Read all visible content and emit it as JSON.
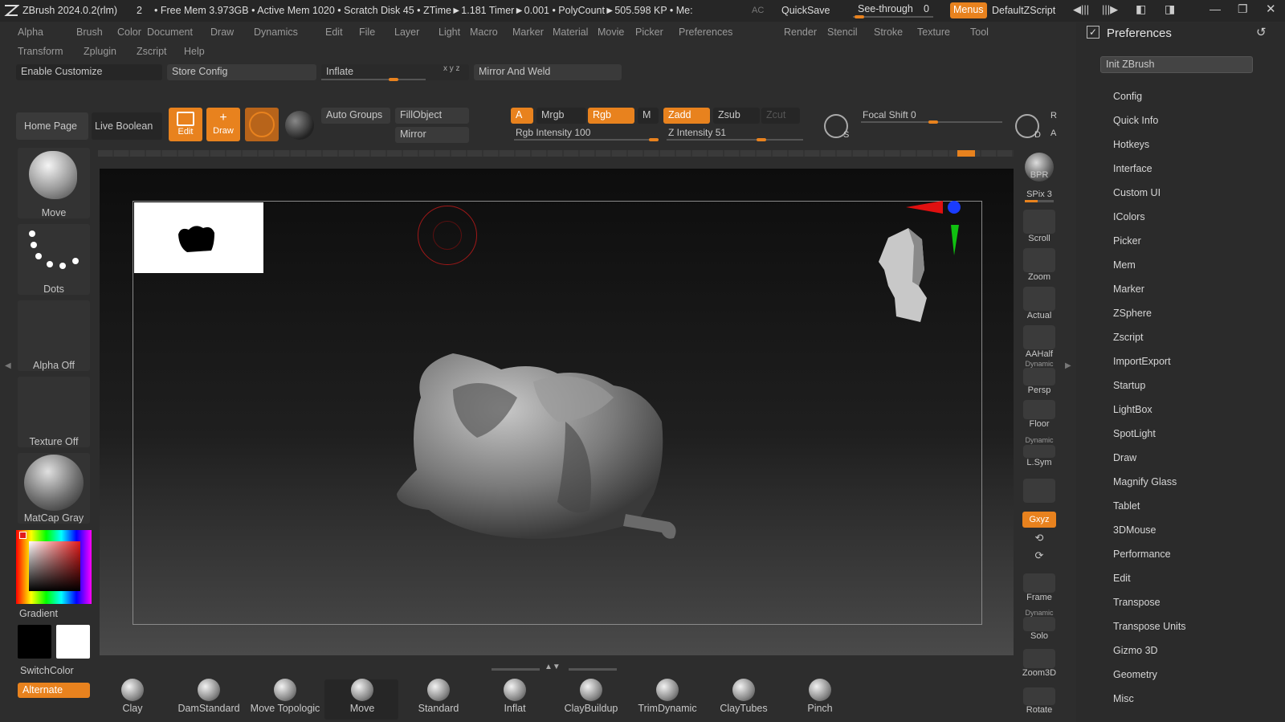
{
  "titlebar": {
    "app": "ZBrush 2024.0.2(rlm)",
    "doc_num": "2",
    "status": "• Free Mem 3.973GB • Active Mem 1020 • Scratch Disk 45 • ZTime►1.181 Timer►0.001 • PolyCount►505.598 KP • Me:",
    "ac": "AC",
    "quicksave": "QuickSave",
    "see_through": "See-through",
    "see_through_val": "0",
    "menus": "Menus",
    "script": "DefaultZScript"
  },
  "menus": {
    "row1": [
      "Alpha",
      "Brush",
      "Color",
      "Document",
      "Draw",
      "Dynamics",
      "Edit",
      "File",
      "Layer",
      "Light",
      "Macro",
      "Marker",
      "Material",
      "Movie",
      "Picker",
      "Preferences",
      "Render",
      "Stencil",
      "Stroke",
      "Texture",
      "Tool"
    ],
    "row2": [
      "Transform",
      "Zplugin",
      "Zscript",
      "Help"
    ]
  },
  "toolbar": {
    "enable_customize": "Enable Customize",
    "store_config": "Store Config",
    "inflate": "Inflate",
    "mirror_weld": "Mirror And Weld",
    "xyz_marks": "x y z",
    "home_page": "Home Page",
    "live_boolean": "Live Boolean",
    "edit": "Edit",
    "draw": "Draw",
    "auto_groups": "Auto Groups",
    "fill_object": "FillObject",
    "mirror": "Mirror",
    "a": "A",
    "mrgb": "Mrgb",
    "rgb": "Rgb",
    "m": "M",
    "zadd": "Zadd",
    "zsub": "Zsub",
    "zcut": "Zcut",
    "rgb_intensity": "Rgb Intensity 100",
    "z_intensity": "Z Intensity 51",
    "focal_shift": "Focal Shift 0",
    "s": "S",
    "d": "D",
    "r": "R",
    "a2": "A"
  },
  "left": {
    "move": "Move",
    "dots": "Dots",
    "alpha_off": "Alpha Off",
    "texture_off": "Texture Off",
    "matcap": "MatCap Gray",
    "gradient": "Gradient",
    "switch_color": "SwitchColor",
    "alternate": "Alternate"
  },
  "right_tools": {
    "bpr": "BPR",
    "spix": "SPix 3",
    "scroll": "Scroll",
    "zoom": "Zoom",
    "actual": "Actual",
    "aahalf": "AAHalf",
    "dynamic": "Dynamic",
    "persp": "Persp",
    "floor": "Floor",
    "lsym": "L.Sym",
    "xyz": "Gxyz",
    "frame": "Frame",
    "solo": "Solo",
    "zoom3d": "Zoom3D",
    "rotate": "Rotate"
  },
  "prefs": {
    "title": "Preferences",
    "init": "Init ZBrush",
    "items": [
      "Config",
      "Quick Info",
      "Hotkeys",
      "Interface",
      "Custom UI",
      "IColors",
      "Picker",
      "Mem",
      "Marker",
      "ZSphere",
      "Zscript",
      "ImportExport",
      "Startup",
      "LightBox",
      "SpotLight",
      "Draw",
      "Magnify Glass",
      "Tablet",
      "3DMouse",
      "Performance",
      "Edit",
      "Transpose",
      "Transpose Units",
      "Gizmo 3D",
      "Geometry",
      "Misc"
    ]
  },
  "brushes": [
    "Clay",
    "DamStandard",
    "Move Topologic",
    "Move",
    "Standard",
    "Inflat",
    "ClayBuildup",
    "TrimDynamic",
    "ClayTubes",
    "Pinch"
  ]
}
